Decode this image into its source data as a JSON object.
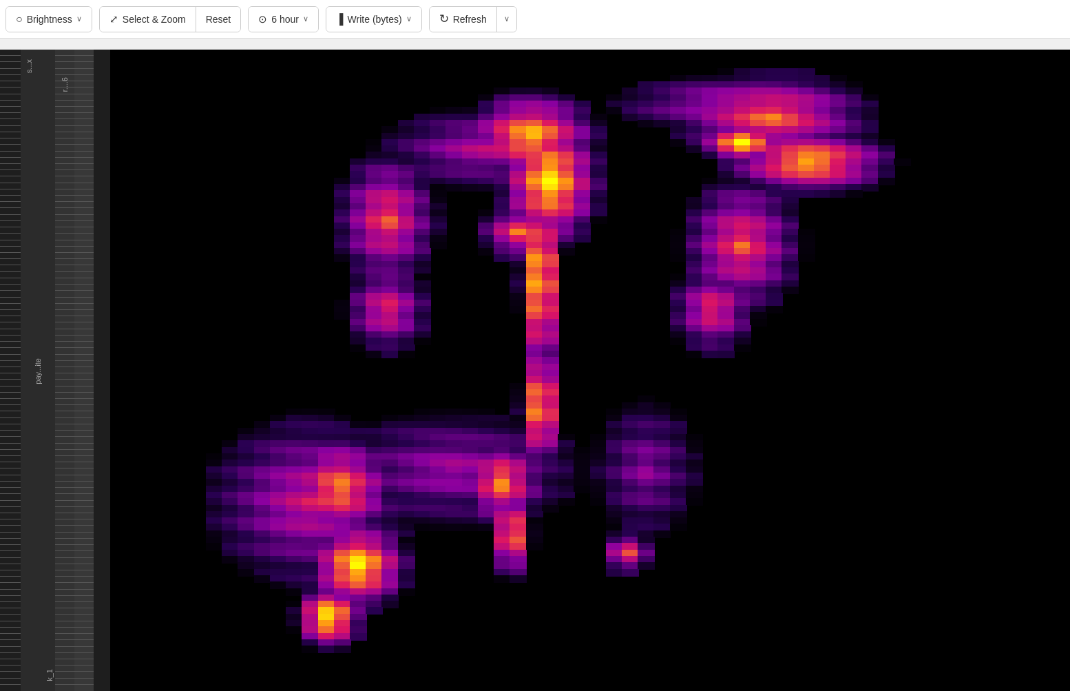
{
  "toolbar": {
    "brightness_label": "Brightness",
    "brightness_chevron": "∨",
    "select_zoom_label": "Select & Zoom",
    "reset_label": "Reset",
    "time_label": "6 hour",
    "time_chevron": "∨",
    "metric_label": "Write (bytes)",
    "metric_chevron": "∨",
    "refresh_label": "Refresh",
    "refresh_chevron": "∨"
  },
  "sidebar": {
    "label_top": "s...x",
    "label_mid": "pay...ite",
    "label_r": "r....6",
    "label_k": "k_1"
  },
  "heatmap": {
    "description": "Heatmap visualization showing write bytes data over 6 hours"
  }
}
